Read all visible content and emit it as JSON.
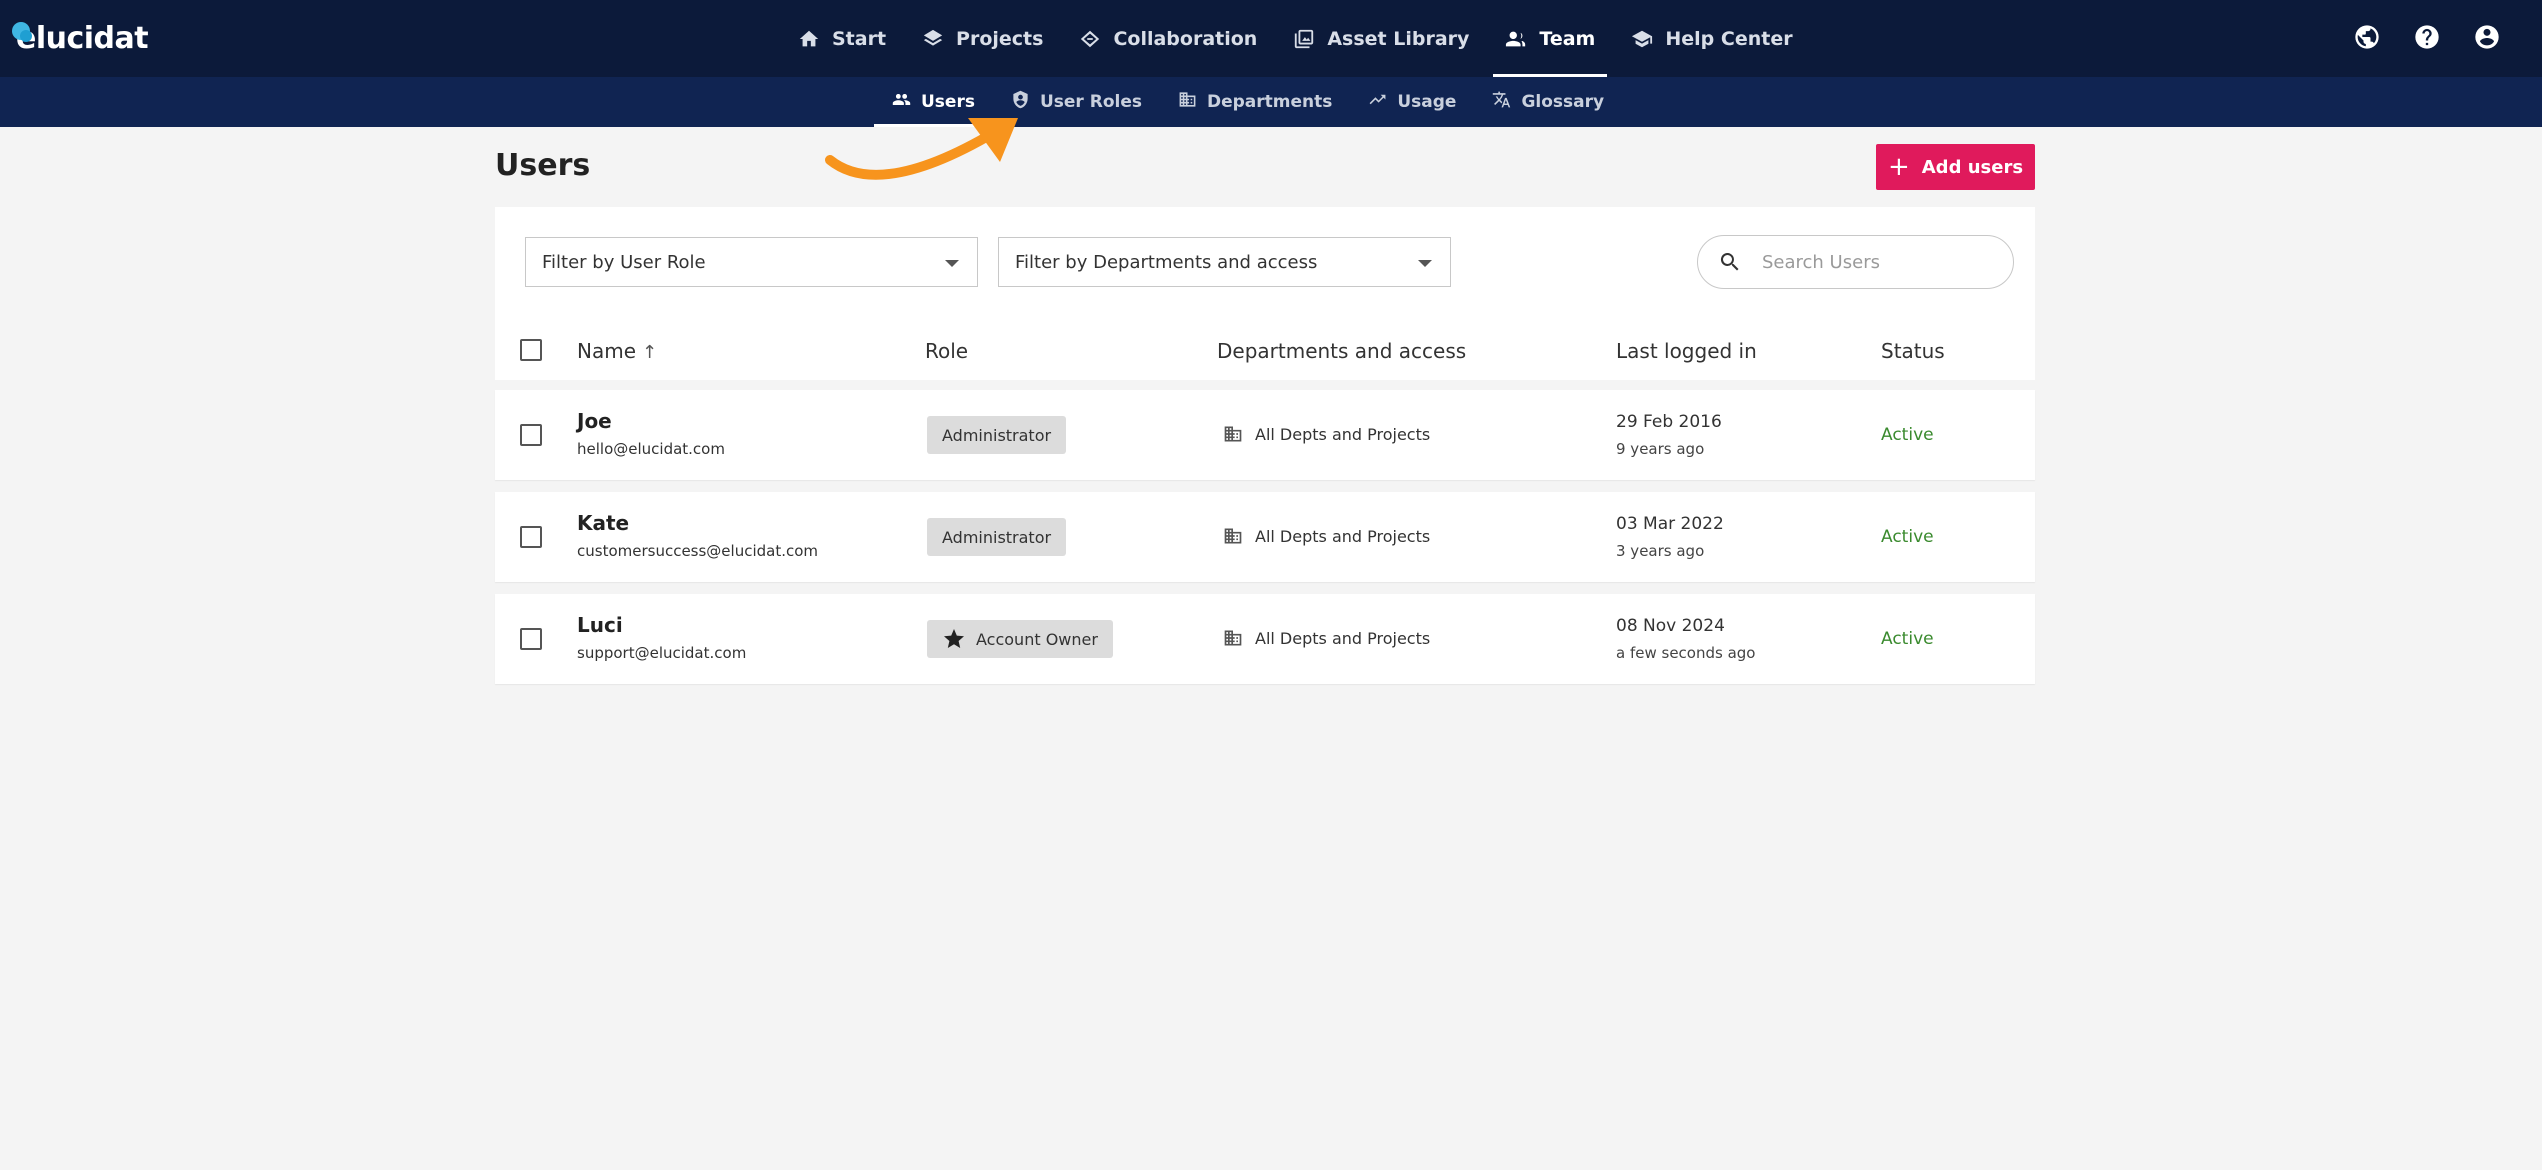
{
  "brand": {
    "name": "elucidat"
  },
  "main_nav": [
    {
      "label": "Start",
      "icon": "home-icon",
      "active": false
    },
    {
      "label": "Projects",
      "icon": "layers-icon",
      "active": false
    },
    {
      "label": "Collaboration",
      "icon": "collaboration-icon",
      "active": false
    },
    {
      "label": "Asset Library",
      "icon": "image-library-icon",
      "active": false
    },
    {
      "label": "Team",
      "icon": "team-icon",
      "active": true
    },
    {
      "label": "Help Center",
      "icon": "graduation-cap-icon",
      "active": false
    }
  ],
  "header_icons": [
    "globe-icon",
    "help-icon",
    "account-icon"
  ],
  "sub_nav": [
    {
      "label": "Users",
      "icon": "users-icon",
      "active": true
    },
    {
      "label": "User Roles",
      "icon": "shield-user-icon",
      "active": false
    },
    {
      "label": "Departments",
      "icon": "building-icon",
      "active": false
    },
    {
      "label": "Usage",
      "icon": "trending-up-icon",
      "active": false
    },
    {
      "label": "Glossary",
      "icon": "translate-icon",
      "active": false
    }
  ],
  "page": {
    "title": "Users",
    "add_button": "Add users"
  },
  "filters": {
    "role": "Filter by User Role",
    "departments": "Filter by Departments and access",
    "search_placeholder": "Search Users"
  },
  "table": {
    "columns": {
      "name": "Name",
      "role": "Role",
      "departments": "Departments and access",
      "last_logged_in": "Last logged in",
      "status": "Status"
    },
    "rows": [
      {
        "name": "Joe",
        "email": "hello@elucidat.com",
        "role": "Administrator",
        "role_icon": "",
        "departments": "All Depts and Projects",
        "date": "29 Feb 2016",
        "ago": "9 years ago",
        "status": "Active"
      },
      {
        "name": "Kate",
        "email": "customersuccess@elucidat.com",
        "role": "Administrator",
        "role_icon": "",
        "departments": "All Depts and Projects",
        "date": "03 Mar 2022",
        "ago": "3 years ago",
        "status": "Active"
      },
      {
        "name": "Luci",
        "email": "support@elucidat.com",
        "role": "Account Owner",
        "role_icon": "star-icon",
        "departments": "All Depts and Projects",
        "date": "08 Nov 2024",
        "ago": "a few seconds ago",
        "status": "Active"
      }
    ]
  },
  "colors": {
    "topbar": "#0c1a3a",
    "subnav": "#102452",
    "accent": "#e01a5c",
    "status_active": "#3a8a2e",
    "annotation_arrow": "#f7941d"
  }
}
